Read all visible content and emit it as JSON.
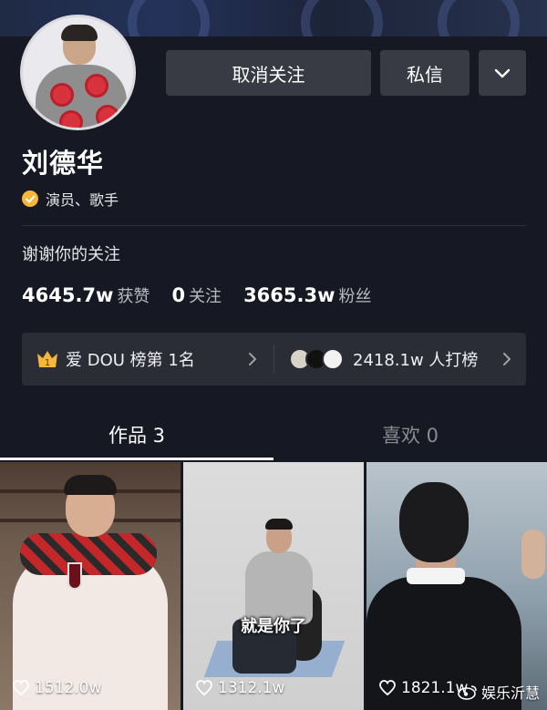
{
  "profile": {
    "name": "刘德华",
    "verified_text": "演员、歌手",
    "bio": "谢谢你的关注"
  },
  "actions": {
    "unfollow_label": "取消关注",
    "message_label": "私信",
    "more_icon": "chevron-down-icon"
  },
  "stats": {
    "likes_value": "4645.7w",
    "likes_label": "获赞",
    "following_value": "0",
    "following_label": "关注",
    "followers_value": "3665.3w",
    "followers_label": "粉丝"
  },
  "ranking": {
    "rank_badge": "1",
    "rank_text": "爱 DOU 榜第 1名",
    "supporters_text": "2418.1w 人打榜"
  },
  "tabs": [
    {
      "label": "作品 3",
      "active": true
    },
    {
      "label": "喜欢 0",
      "active": false
    }
  ],
  "videos": [
    {
      "likes": "1512.0w",
      "caption": ""
    },
    {
      "likes": "1312.1w",
      "caption": "就是你了"
    },
    {
      "likes": "1821.1w",
      "caption": ""
    }
  ],
  "watermark": "娱乐沂慧",
  "colors": {
    "background": "#161823",
    "button": "#393b44",
    "card": "#2a2c36",
    "verify_badge": "#f4b73a"
  }
}
